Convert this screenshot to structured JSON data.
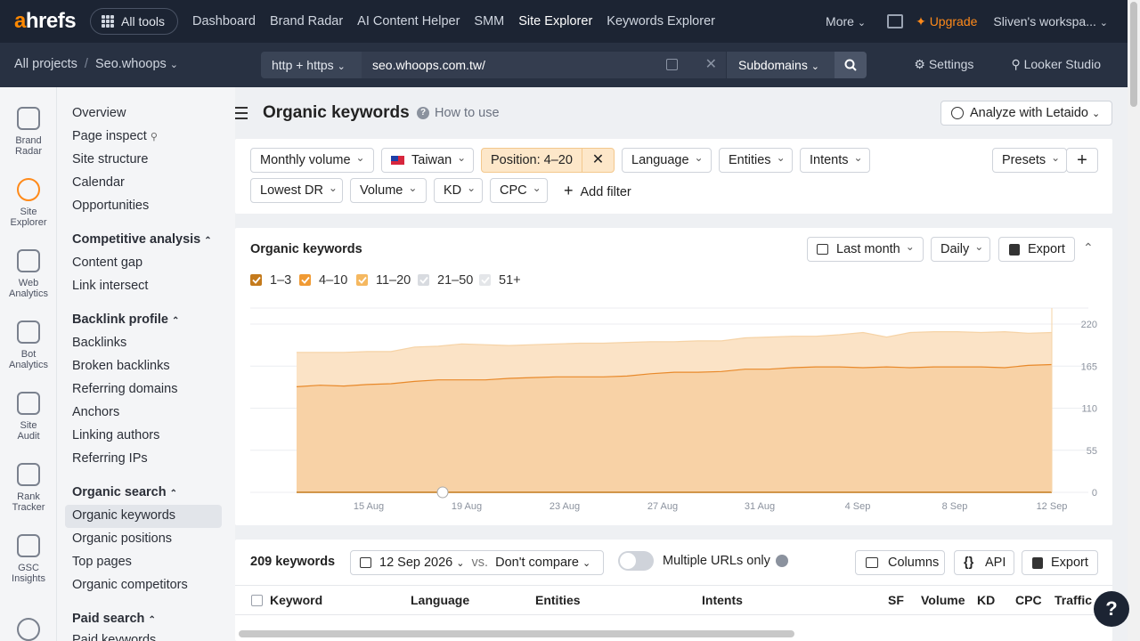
{
  "topnav": {
    "logo_a": "a",
    "logo_rest": "hrefs",
    "all_tools": "All tools",
    "links": [
      "Dashboard",
      "Brand Radar",
      "AI Content Helper",
      "SMM",
      "Site Explorer",
      "Keywords Explorer"
    ],
    "more": "More",
    "upgrade": "Upgrade",
    "workspace": "Sliven's workspa..."
  },
  "subbar": {
    "all_projects": "All projects",
    "project": "Seo.whoops",
    "protocol": "http + https",
    "url": "seo.whoops.com.tw/",
    "mode": "Subdomains",
    "settings": "Settings",
    "looker": "Looker Studio"
  },
  "rail": [
    {
      "label1": "Brand",
      "label2": "Radar",
      "icon": "brand-radar-icon"
    },
    {
      "label1": "Site",
      "label2": "Explorer",
      "icon": "site-explorer-icon"
    },
    {
      "label1": "Web",
      "label2": "Analytics",
      "icon": "web-analytics-icon"
    },
    {
      "label1": "Bot",
      "label2": "Analytics",
      "icon": "bot-analytics-icon"
    },
    {
      "label1": "Site",
      "label2": "Audit",
      "icon": "site-audit-icon"
    },
    {
      "label1": "Rank",
      "label2": "Tracker",
      "icon": "rank-tracker-icon"
    },
    {
      "label1": "GSC",
      "label2": "Insights",
      "icon": "gsc-insights-icon"
    }
  ],
  "sidebar": {
    "top": [
      "Overview",
      "Page inspect",
      "Site structure",
      "Calendar",
      "Opportunities"
    ],
    "competitive_heading": "Competitive analysis",
    "competitive": [
      "Content gap",
      "Link intersect"
    ],
    "backlink_heading": "Backlink profile",
    "backlink": [
      "Backlinks",
      "Broken backlinks",
      "Referring domains",
      "Anchors",
      "Linking authors",
      "Referring IPs"
    ],
    "organic_heading": "Organic search",
    "organic": [
      "Organic keywords",
      "Organic positions",
      "Top pages",
      "Organic competitors"
    ],
    "paid_heading": "Paid search",
    "paid": [
      "Paid keywords"
    ]
  },
  "header": {
    "title": "Organic keywords",
    "how_to": "How to use",
    "analyze": "Analyze with Letaido"
  },
  "filters": {
    "monthly_volume": "Monthly volume",
    "country": "Taiwan",
    "position": "Position: 4–20",
    "language": "Language",
    "entities": "Entities",
    "intents": "Intents",
    "presets": "Presets",
    "lowest_dr": "Lowest DR",
    "volume": "Volume",
    "kd": "KD",
    "cpc": "CPC",
    "add_filter": "Add filter"
  },
  "chart_panel": {
    "title": "Organic keywords",
    "period": "Last month",
    "granularity": "Daily",
    "export": "Export",
    "legend": [
      {
        "label": "1–3",
        "checked": true,
        "color": "#c47a1c"
      },
      {
        "label": "4–10",
        "checked": true,
        "color": "#f09a34"
      },
      {
        "label": "11–20",
        "checked": true,
        "color": "#f5b860"
      },
      {
        "label": "21–50",
        "checked": false,
        "color": "#c8ccd3"
      },
      {
        "label": "51+",
        "checked": false,
        "color": "#d8dbe0"
      }
    ]
  },
  "chart_data": {
    "type": "area",
    "x_ticks": [
      "15 Aug",
      "19 Aug",
      "23 Aug",
      "27 Aug",
      "31 Aug",
      "4 Sep",
      "8 Sep",
      "12 Sep"
    ],
    "y_ticks": [
      "0",
      "55",
      "110",
      "165",
      "220"
    ],
    "ylim": [
      0,
      220
    ],
    "series": [
      {
        "name": "4–10",
        "color": "#f09a34",
        "values": [
          138,
          140,
          139,
          141,
          142,
          145,
          147,
          147,
          147,
          149,
          150,
          151,
          151,
          151,
          152,
          155,
          157,
          157,
          158,
          161,
          161,
          163,
          164,
          164,
          163,
          164,
          163,
          164,
          164,
          164,
          163,
          166,
          167
        ]
      },
      {
        "name": "11–20",
        "color": "#f5b860",
        "values": [
          183,
          183,
          183,
          184,
          184,
          190,
          191,
          194,
          193,
          192,
          193,
          194,
          195,
          195,
          196,
          197,
          197,
          198,
          198,
          202,
          203,
          204,
          204,
          206,
          209,
          203,
          209,
          210,
          210,
          209,
          210,
          208,
          209
        ]
      }
    ],
    "grid": true
  },
  "table": {
    "count": "209 keywords",
    "date": "12 Sep 2026",
    "vs": "vs.",
    "compare": "Don't compare",
    "multiple_urls": "Multiple URLs only",
    "columns": "Columns",
    "api": "API",
    "export": "Export",
    "headers": [
      "Keyword",
      "Language",
      "Entities",
      "Intents",
      "SF",
      "Volume",
      "KD",
      "CPC",
      "Traffic"
    ]
  }
}
